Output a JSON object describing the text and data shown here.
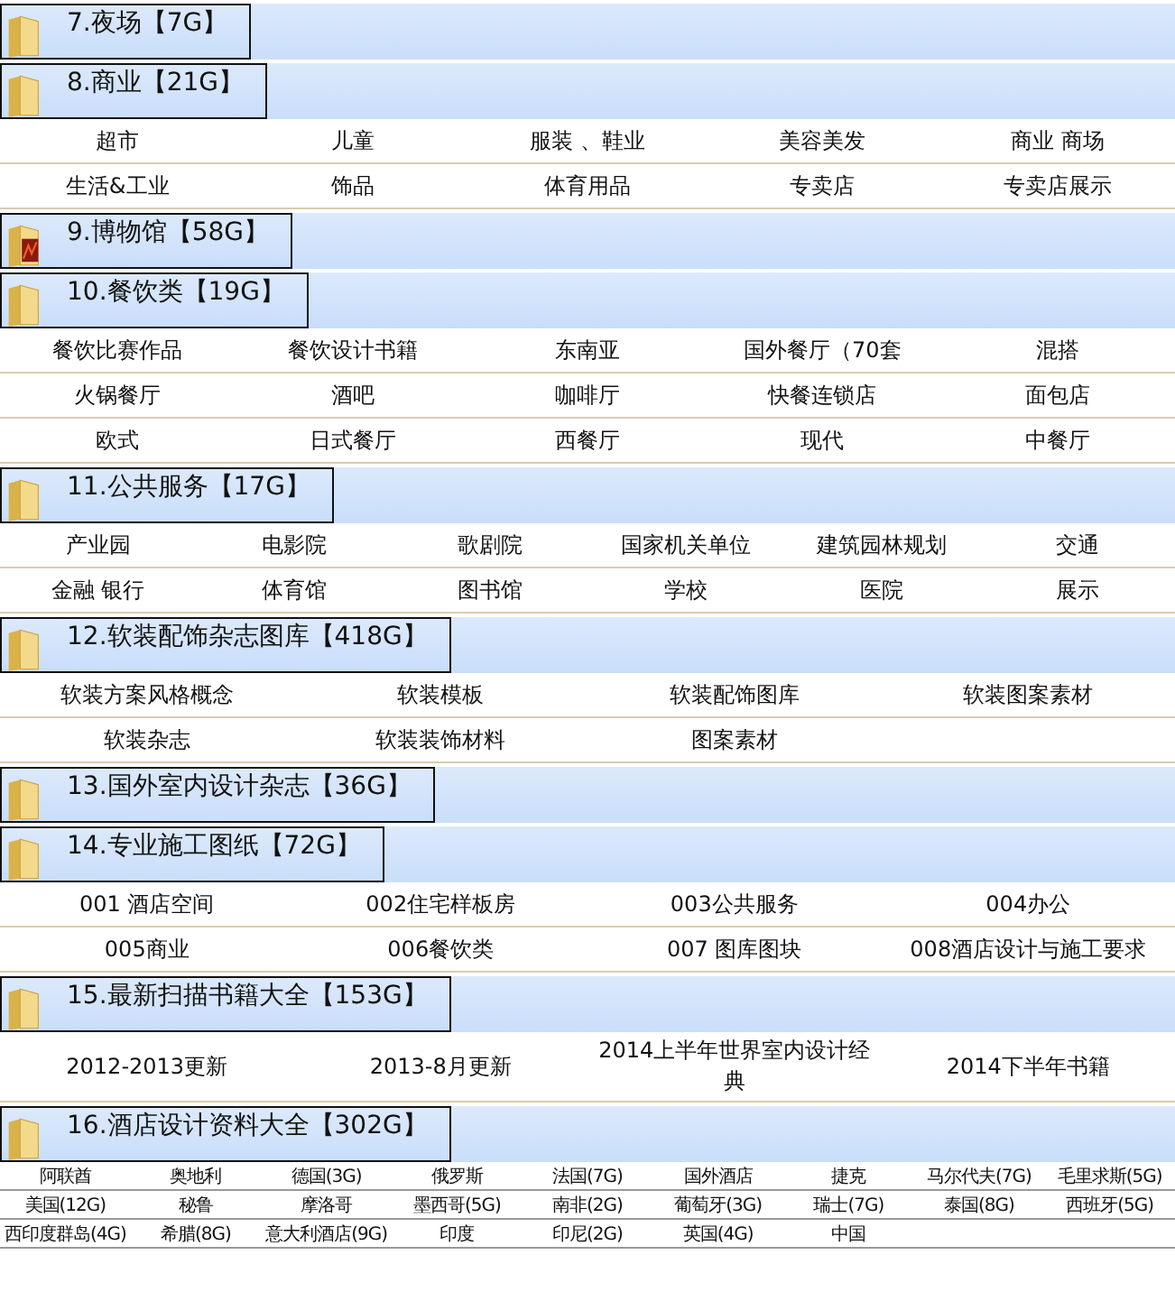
{
  "sections": [
    {
      "title": "7.夜场【7G】"
    },
    {
      "title": "8.商业【21G】",
      "rows": [
        [
          "超市",
          "儿童",
          "服装 、鞋业",
          "美容美发",
          "商业  商场"
        ],
        [
          "生活&工业",
          "饰品",
          "体育用品",
          "专卖店",
          "专卖店展示"
        ]
      ]
    },
    {
      "title": "9.博物馆【58G】"
    },
    {
      "title": "10.餐饮类【19G】",
      "rows": [
        [
          "餐饮比赛作品",
          "餐饮设计书籍",
          "东南亚",
          "国外餐厅（70套",
          "混搭"
        ],
        [
          "火锅餐厅",
          "酒吧",
          "咖啡厅",
          "快餐连锁店",
          "面包店"
        ],
        [
          "欧式",
          "日式餐厅",
          "西餐厅",
          "现代",
          "中餐厅"
        ]
      ]
    },
    {
      "title": "11.公共服务【17G】",
      "rows": [
        [
          "产业园",
          "电影院",
          "歌剧院",
          "国家机关单位",
          "建筑园林规划",
          "交通"
        ],
        [
          "金融 银行",
          "体育馆",
          "图书馆",
          "学校",
          "医院",
          "展示"
        ]
      ]
    },
    {
      "title": "12.软装配饰杂志图库【418G】",
      "rows": [
        [
          "软装方案风格概念",
          "软装模板",
          "软装配饰图库",
          "软装图案素材"
        ],
        [
          "软装杂志",
          "软装装饰材料",
          "图案素材"
        ]
      ]
    },
    {
      "title": "13.国外室内设计杂志【36G】"
    },
    {
      "title": "14.专业施工图纸【72G】",
      "rows": [
        [
          "001 酒店空间",
          "002住宅样板房",
          "003公共服务",
          "004办公"
        ],
        [
          "005商业",
          "006餐饮类",
          "007 图库图块",
          "008酒店设计与施工要求"
        ]
      ]
    },
    {
      "title": "15.最新扫描书籍大全【153G】",
      "rows": [
        [
          "2012-2013更新",
          "2013-8月更新",
          "2014上半年世界室内设计经典",
          "2014下半年书籍"
        ]
      ]
    },
    {
      "title": "16.酒店设计资料大全【302G】",
      "rows": [
        [
          "阿联酋",
          "奥地利",
          "德国(3G)",
          "俄罗斯",
          "法国(7G)",
          "国外酒店",
          "捷克",
          "马尔代夫(7G)",
          "毛里求斯(5G)"
        ],
        [
          "美国(12G)",
          "秘鲁",
          "摩洛哥",
          "墨西哥(5G)",
          "南非(2G)",
          "葡萄牙(3G)",
          "瑞士(7G)",
          "泰国(8G)",
          "西班牙(5G)"
        ],
        [
          "西印度群岛(4G)",
          "希腊(8G)",
          "意大利酒店(9G)",
          "印度",
          "印尼(2G)",
          "英国(4G)",
          "中国"
        ]
      ]
    }
  ]
}
